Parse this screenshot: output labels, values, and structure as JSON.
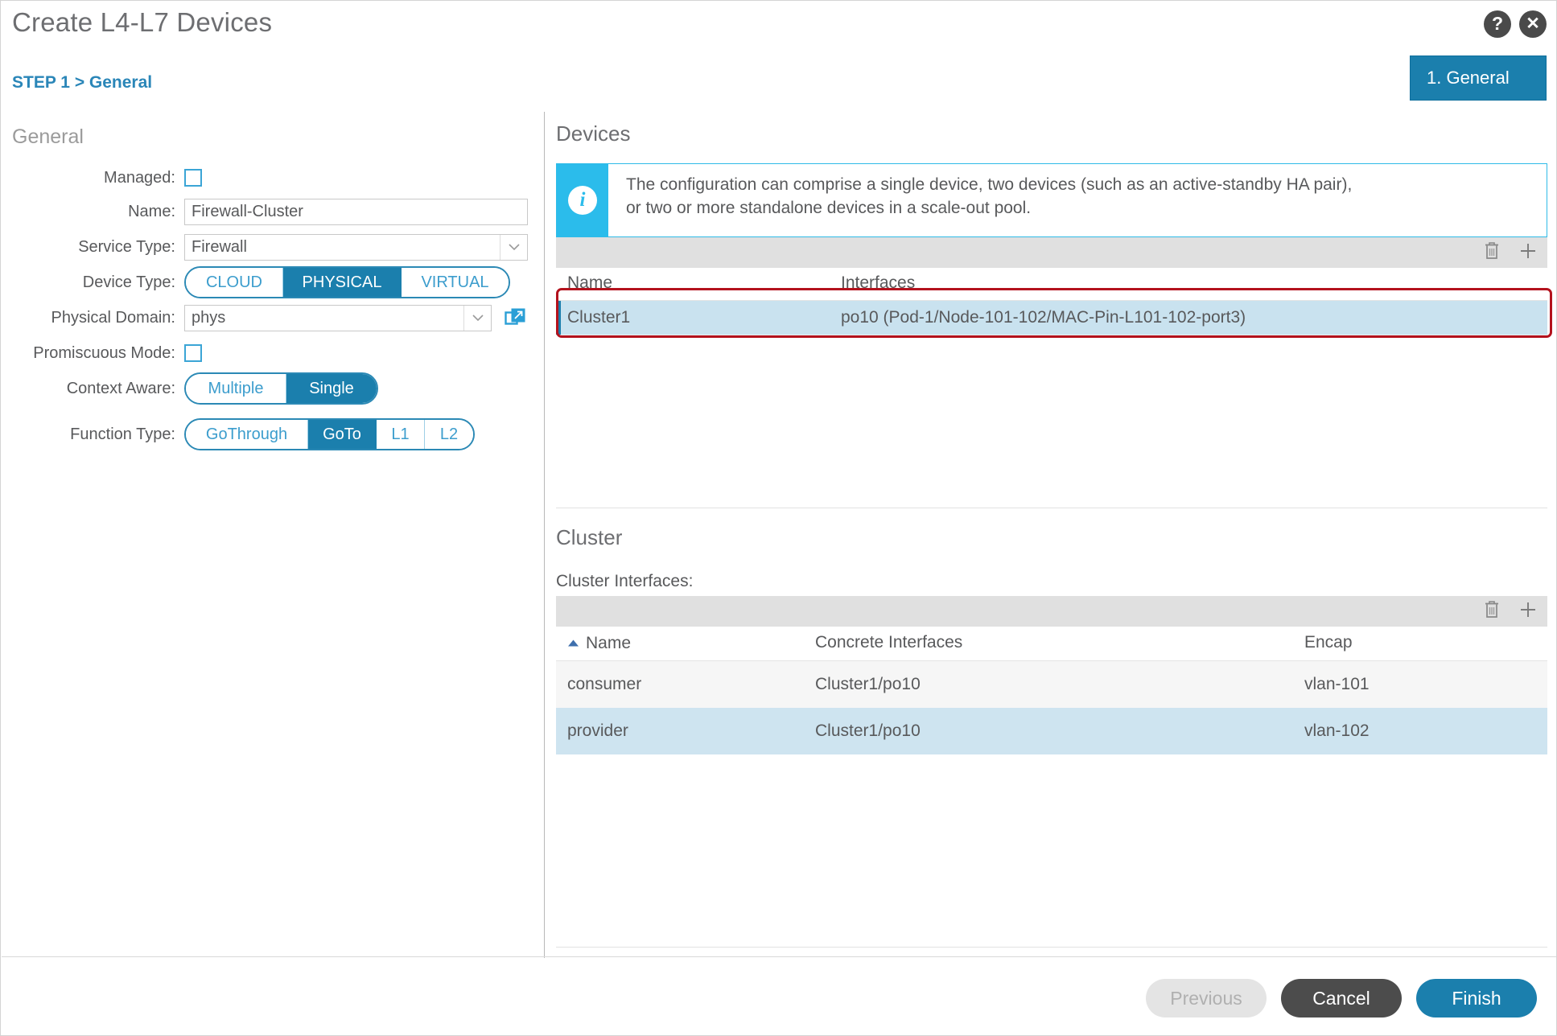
{
  "header": {
    "title": "Create L4-L7 Devices",
    "breadcrumb": "STEP 1 > General",
    "help_icon": "question-mark-icon",
    "close_icon": "close-icon",
    "step_tab_label": "1. General"
  },
  "colors": {
    "accent_blue": "#1b7fad",
    "link_blue": "#2a86b8",
    "info_cyan": "#2bbceb",
    "highlight_red": "#b3121d",
    "row_selected": "#c9e2ef",
    "toolbar_gray": "#e0e0e0"
  },
  "left": {
    "section_title": "General",
    "managed": {
      "label": "Managed:",
      "checked": false
    },
    "name": {
      "label": "Name:",
      "value": "Firewall-Cluster",
      "placeholder": ""
    },
    "service_type": {
      "label": "Service Type:",
      "value": "Firewall"
    },
    "device_type": {
      "label": "Device Type:",
      "options": [
        "CLOUD",
        "PHYSICAL",
        "VIRTUAL"
      ],
      "selected": "PHYSICAL"
    },
    "physical_domain": {
      "label": "Physical Domain:",
      "value": "phys",
      "link_icon": "external-link-icon"
    },
    "promiscuous_mode": {
      "label": "Promiscuous Mode:",
      "checked": false
    },
    "context_aware": {
      "label": "Context Aware:",
      "options": [
        "Multiple",
        "Single"
      ],
      "selected": "Single"
    },
    "function_type": {
      "label": "Function Type:",
      "options": [
        "GoThrough",
        "GoTo",
        "L1",
        "L2"
      ],
      "selected": "GoTo"
    }
  },
  "devices": {
    "heading": "Devices",
    "info_line1": "The configuration can comprise a single device, two devices (such as an active-standby HA pair),",
    "info_line2": "or two or more standalone devices in a scale-out pool.",
    "info_icon": "info-icon",
    "toolbar": {
      "delete_icon": "trash-icon",
      "add_icon": "plus-icon"
    },
    "columns": [
      "Name",
      "Interfaces"
    ],
    "rows": [
      {
        "name": "Cluster1",
        "interfaces": "po10 (Pod-1/Node-101-102/MAC-Pin-L101-102-port3)",
        "selected": true
      }
    ]
  },
  "cluster": {
    "heading": "Cluster",
    "interfaces_label": "Cluster Interfaces:",
    "toolbar": {
      "delete_icon": "trash-icon",
      "add_icon": "plus-icon"
    },
    "columns": [
      "Name",
      "Concrete Interfaces",
      "Encap"
    ],
    "sort_column": "Name",
    "sort_direction": "ascending",
    "sort_icon": "caret-up-icon",
    "rows": [
      {
        "name": "consumer",
        "concrete_interfaces": "Cluster1/po10",
        "encap": "vlan-101"
      },
      {
        "name": "provider",
        "concrete_interfaces": "Cluster1/po10",
        "encap": "vlan-102"
      }
    ]
  },
  "footer": {
    "previous_label": "Previous",
    "cancel_label": "Cancel",
    "finish_label": "Finish"
  }
}
